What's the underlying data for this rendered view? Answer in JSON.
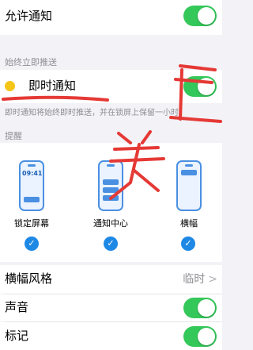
{
  "allow_notifications": {
    "label": "允许通知",
    "enabled": true
  },
  "always_push_section_title": "始终立即推送",
  "instant": {
    "label": "即时通知",
    "enabled": true,
    "description": "即时通知将始终即时推送，并在锁屏上保留一小时。"
  },
  "alerts_section_title": "提醒",
  "phone_time": "09:41",
  "alert_styles": [
    {
      "label": "锁定屏幕",
      "checked": true
    },
    {
      "label": "通知中心",
      "checked": true
    },
    {
      "label": "横幅",
      "checked": true
    }
  ],
  "banner_style": {
    "label": "横幅风格",
    "value": "临时"
  },
  "sound": {
    "label": "声音",
    "enabled": true
  },
  "badges": {
    "label": "标记",
    "enabled": true
  },
  "colors": {
    "toggle_on": "#34c759",
    "accent": "#4a90e2",
    "annotation": "#e53935"
  }
}
